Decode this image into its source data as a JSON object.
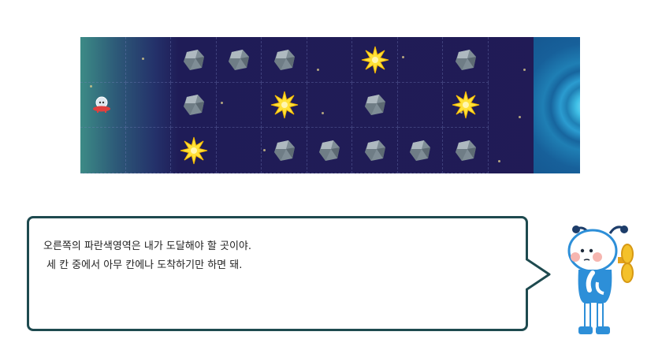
{
  "game": {
    "grid": {
      "rows": 3,
      "cols": 10
    },
    "player": {
      "row": 2,
      "col": 1,
      "icon": "ufo-icon"
    },
    "goal": {
      "col": 10,
      "color": "#1f7fb4"
    },
    "rocks": [
      {
        "row": 1,
        "col": 3
      },
      {
        "row": 1,
        "col": 4
      },
      {
        "row": 1,
        "col": 5
      },
      {
        "row": 1,
        "col": 9
      },
      {
        "row": 2,
        "col": 3
      },
      {
        "row": 2,
        "col": 7
      },
      {
        "row": 3,
        "col": 5
      },
      {
        "row": 3,
        "col": 6
      },
      {
        "row": 3,
        "col": 7
      },
      {
        "row": 3,
        "col": 8
      },
      {
        "row": 3,
        "col": 9
      }
    ],
    "stars": [
      {
        "row": 1,
        "col": 7
      },
      {
        "row": 2,
        "col": 5
      },
      {
        "row": 2,
        "col": 9
      },
      {
        "row": 3,
        "col": 3
      }
    ],
    "colors": {
      "rock": "#7f8d96",
      "star": "#ffe23a",
      "space": "#211b56",
      "edge": "#3c8b86"
    }
  },
  "dialog": {
    "line1": "오른쪽의 파란색영역은 내가 도달해야 할 곳이야.",
    "line2": "세 칸 중에서 아무 칸에나 도착하기만 하면 돼."
  },
  "character": {
    "icon": "robot-mascot-icon",
    "accent": "#2d8fd8"
  }
}
